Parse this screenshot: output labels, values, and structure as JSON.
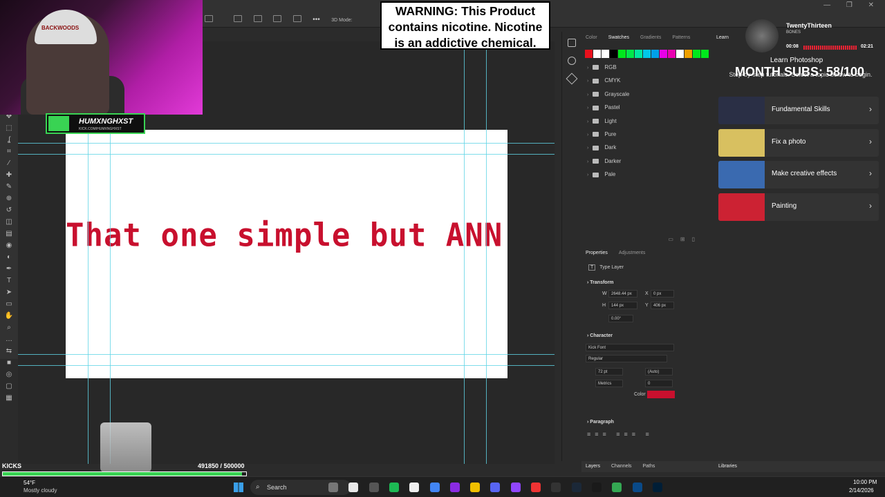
{
  "app": {
    "name": "Photoshop",
    "mode_label": "3D Mode:"
  },
  "window_controls": "— ❐ ✕",
  "toolbar": {
    "tools": [
      "move-tool",
      "marquee-tool",
      "lasso-tool",
      "crop-tool",
      "eyedropper-tool",
      "healing-tool",
      "brush-tool",
      "stamp-tool",
      "history-brush-tool",
      "eraser-tool",
      "gradient-tool",
      "blur-tool",
      "dodge-tool",
      "pen-tool",
      "type-tool",
      "path-select-tool",
      "shape-tool",
      "hand-tool",
      "zoom-tool",
      "more-tools",
      "swap-colors",
      "foreground-color",
      "quick-mask",
      "screen-mode",
      "frame-tool"
    ]
  },
  "canvas": {
    "text": "That one simple but ANN"
  },
  "overlay": {
    "warning": "WARNING: This Product contains nicotine. Nicotine is an addictive chemical.",
    "streamer_name": "HUMXNGHXST",
    "streamer_sub": "KICK.COM/HUMXNGHXST",
    "hat_text": "BACKWOODS",
    "subs_goal": "MONTH SUBS: 58/100",
    "kicks_label": "KICKS",
    "kicks_count": "491850  / 500000",
    "kicks_progress": 0.9837
  },
  "swatches_panel": {
    "tabs": [
      "Color",
      "Swatches",
      "Gradients",
      "Patterns"
    ],
    "active_tab": "Swatches",
    "swatch_colors": [
      "#e8101c",
      "#ffffff",
      "#ffffff",
      "#000000",
      "#00e81c",
      "#00e84a",
      "#00e8a0",
      "#00c8e8",
      "#00a0e8",
      "#e800e8",
      "#e800b0",
      "#ffffff",
      "#f0a000",
      "#00e81c",
      "#00e81c"
    ],
    "folders": [
      "RGB",
      "CMYK",
      "Grayscale",
      "Pastel",
      "Light",
      "Pure",
      "Dark",
      "Darker",
      "Pale"
    ]
  },
  "properties_panel": {
    "tabs": [
      "Properties",
      "Adjustments"
    ],
    "layer_type": "Type Layer",
    "transform_label": "Transform",
    "w_label": "W",
    "w": "2648.44 px",
    "h_label": "H",
    "h": "144 px",
    "x_label": "X",
    "x": "0 px",
    "y_label": "Y",
    "y": "406 px",
    "angle": "0.00°",
    "character_label": "Character",
    "font": "Kick Font",
    "style": "Regular",
    "size": "72 pt",
    "leading": "(Auto)",
    "kerning": "Metrics",
    "tracking": "0",
    "color_label": "Color",
    "text_color": "#c8102e",
    "paragraph_label": "Paragraph"
  },
  "learn_panel": {
    "tab": "Learn",
    "title": "Learn Photoshop",
    "subtitle": "Step-by-step tutorials. Select a topic below to begin.",
    "cards": [
      {
        "label": "Fundamental Skills"
      },
      {
        "label": "Fix a photo"
      },
      {
        "label": "Make creative effects"
      },
      {
        "label": "Painting"
      }
    ]
  },
  "music": {
    "title": "TwentyThirteen",
    "artist": "BONES",
    "elapsed": "00:08",
    "total": "02:21"
  },
  "bottom_tabs": {
    "layers": "Layers",
    "channels": "Channels",
    "paths": "Paths",
    "libraries": "Libraries"
  },
  "taskbar": {
    "temp": "54°F",
    "weather": "Mostly cloudy",
    "search": "Search",
    "time": "10:00 PM",
    "date": "2/14/2026"
  }
}
